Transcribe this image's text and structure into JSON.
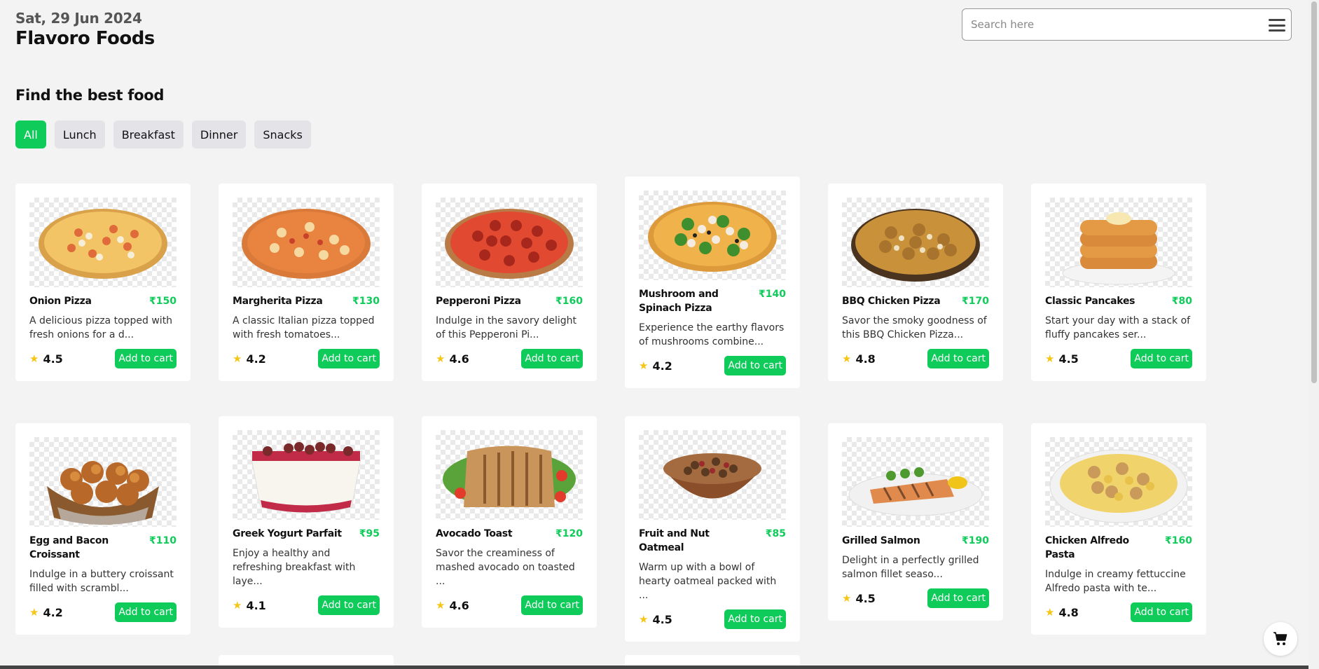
{
  "header": {
    "date": "Sat, 29 Jun 2024",
    "brand": "Flavoro Foods"
  },
  "search": {
    "placeholder": "Search here"
  },
  "section_title": "Find the best food",
  "tabs": [
    {
      "label": "All",
      "active": true
    },
    {
      "label": "Lunch",
      "active": false
    },
    {
      "label": "Breakfast",
      "active": false
    },
    {
      "label": "Dinner",
      "active": false
    },
    {
      "label": "Snacks",
      "active": false
    }
  ],
  "add_label": "Add to cart",
  "star": "★",
  "items": [
    {
      "name": "Onion Pizza",
      "price": "₹150",
      "desc": "A delicious pizza topped with fresh onions for a d...",
      "rating": "4.5",
      "food": "pizza-onion"
    },
    {
      "name": "Margherita Pizza",
      "price": "₹130",
      "desc": "A classic Italian pizza topped with fresh tomatoes...",
      "rating": "4.2",
      "food": "pizza-margherita"
    },
    {
      "name": "Pepperoni Pizza",
      "price": "₹160",
      "desc": "Indulge in the savory delight of this Pepperoni Pi...",
      "rating": "4.6",
      "food": "pizza-pepperoni"
    },
    {
      "name": "Mushroom and Spinach Pizza",
      "price": "₹140",
      "desc": "Experience the earthy flavors of mushrooms combine...",
      "rating": "4.2",
      "food": "pizza-mushroom"
    },
    {
      "name": "BBQ Chicken Pizza",
      "price": "₹170",
      "desc": "Savor the smoky goodness of this BBQ Chicken Pizza...",
      "rating": "4.8",
      "food": "pizza-bbq"
    },
    {
      "name": "Classic Pancakes",
      "price": "₹80",
      "desc": "Start your day with a stack of fluffy pancakes ser...",
      "rating": "4.5",
      "food": "pancakes"
    },
    {
      "name": "Egg and Bacon Croissant",
      "price": "₹110",
      "desc": "Indulge in a buttery croissant filled with scrambl...",
      "rating": "4.2",
      "food": "croissant"
    },
    {
      "name": "Greek Yogurt Parfait",
      "price": "₹95",
      "desc": "Enjoy a healthy and refreshing breakfast with laye...",
      "rating": "4.1",
      "food": "parfait"
    },
    {
      "name": "Avocado Toast",
      "price": "₹120",
      "desc": "Savor the creaminess of mashed avocado on toasted ...",
      "rating": "4.6",
      "food": "toast"
    },
    {
      "name": "Fruit and Nut Oatmeal",
      "price": "₹85",
      "desc": "Warm up with a bowl of hearty oatmeal packed with ...",
      "rating": "4.5",
      "food": "oatmeal"
    },
    {
      "name": "Grilled Salmon",
      "price": "₹190",
      "desc": "Delight in a perfectly grilled salmon fillet seaso...",
      "rating": "4.5",
      "food": "salmon"
    },
    {
      "name": "Chicken Alfredo Pasta",
      "price": "₹160",
      "desc": "Indulge in creamy fettuccine Alfredo pasta with te...",
      "rating": "4.8",
      "food": "pasta"
    }
  ],
  "colors": {
    "accent": "#0fcb5a",
    "background": "#f3f3f3",
    "star": "#f5c518"
  },
  "icons": {
    "menu": "hamburger-menu-icon",
    "cart": "shopping-cart-icon",
    "rating": "star-icon"
  }
}
